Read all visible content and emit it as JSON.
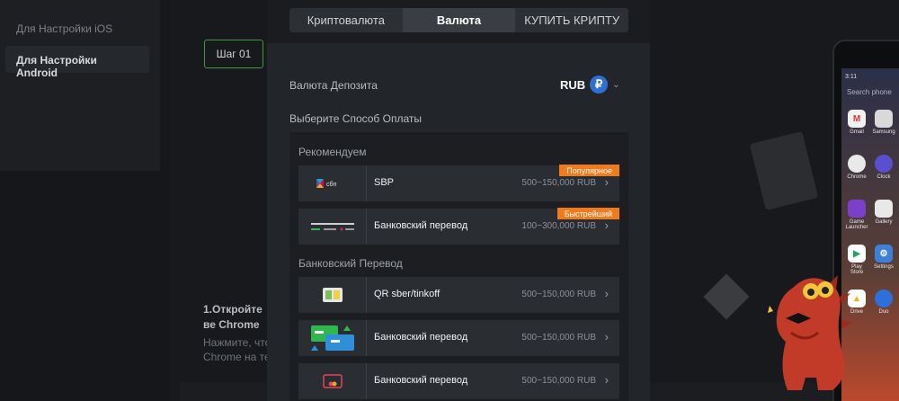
{
  "sidebar": {
    "items": [
      {
        "label": "Для Настройки iOS"
      },
      {
        "label": "Для Настройки Android"
      }
    ]
  },
  "background": {
    "step_label": "Шаг 01",
    "instruction_title": "1.Откройте ве Chrome",
    "instruction_text": "Нажмите, что Chrome на те"
  },
  "phone": {
    "status": "3:11",
    "search_placeholder": "Search phone",
    "apps": [
      {
        "label": "Gmail",
        "glyph": "M"
      },
      {
        "label": "Samsung",
        "glyph": ""
      },
      {
        "label": "Chrome",
        "glyph": ""
      },
      {
        "label": "Clock",
        "glyph": ""
      },
      {
        "label": "Game Launcher",
        "glyph": ""
      },
      {
        "label": "Gallery",
        "glyph": ""
      },
      {
        "label": "Play Store",
        "glyph": "▶"
      },
      {
        "label": "Settings",
        "glyph": "⚙"
      },
      {
        "label": "Drive",
        "glyph": "▲"
      },
      {
        "label": "Duo",
        "glyph": ""
      }
    ]
  },
  "modal": {
    "tabs": [
      {
        "label": "Криптовалюта",
        "active": false
      },
      {
        "label": "Валюта",
        "active": true
      },
      {
        "label": "КУПИТЬ КРИПТУ",
        "active": false
      }
    ],
    "deposit_currency_label": "Валюта Депозита",
    "currency_code": "RUB",
    "currency_symbol": "₽",
    "payment_method_label": "Выберите Способ Оплаты",
    "sections": [
      {
        "title": "Рекомендуем",
        "methods": [
          {
            "name": "SBP",
            "range": "500~150,000 RUB",
            "badge": "Популярное",
            "logo_text": "сбп"
          },
          {
            "name": "Банковский перевод",
            "range": "100~300,000 RUB",
            "badge": "Быстрейший",
            "logo_text": ""
          }
        ]
      },
      {
        "title": "Банковский Перевод",
        "methods": [
          {
            "name": "QR sber/tinkoff",
            "range": "500~150,000 RUB"
          },
          {
            "name": "Банковский перевод",
            "range": "500~150,000 RUB"
          },
          {
            "name": "Банковский перевод",
            "range": "500~150,000 RUB"
          }
        ]
      }
    ]
  },
  "colors": {
    "accent_badge": "#f07b1c",
    "rub_icon": "#2f6fd1",
    "step_border": "#3f9a3f"
  }
}
